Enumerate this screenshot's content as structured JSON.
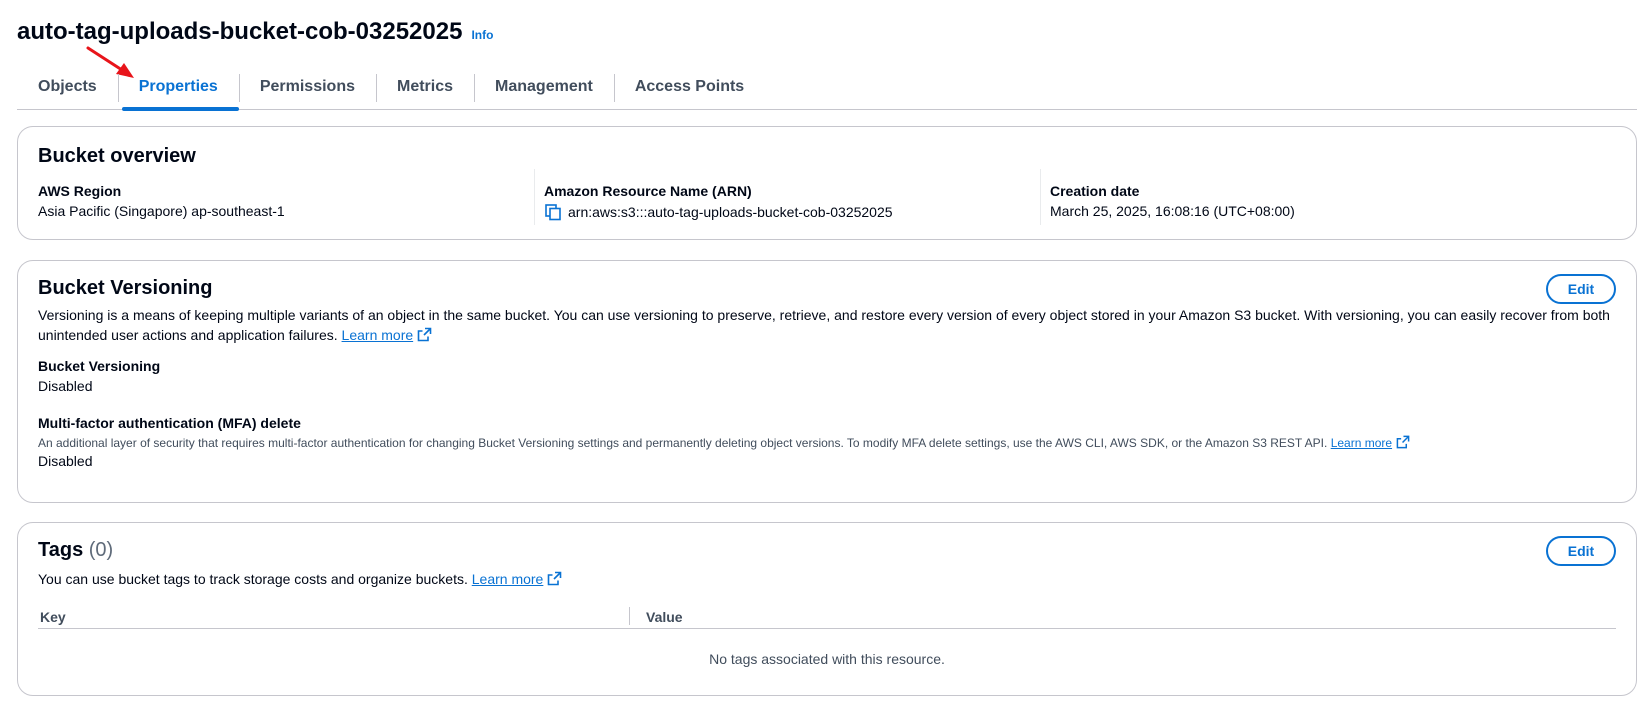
{
  "header": {
    "title": "auto-tag-uploads-bucket-cob-03252025",
    "info_label": "Info"
  },
  "tabs": [
    {
      "label": "Objects",
      "active": false
    },
    {
      "label": "Properties",
      "active": true
    },
    {
      "label": "Permissions",
      "active": false
    },
    {
      "label": "Metrics",
      "active": false
    },
    {
      "label": "Management",
      "active": false
    },
    {
      "label": "Access Points",
      "active": false
    }
  ],
  "overview": {
    "title": "Bucket overview",
    "region_label": "AWS Region",
    "region_value": "Asia Pacific (Singapore) ap-southeast-1",
    "arn_label": "Amazon Resource Name (ARN)",
    "arn_value": "arn:aws:s3:::auto-tag-uploads-bucket-cob-03252025",
    "creation_label": "Creation date",
    "creation_value": "March 25, 2025, 16:08:16 (UTC+08:00)"
  },
  "versioning": {
    "title": "Bucket Versioning",
    "edit_label": "Edit",
    "description": "Versioning is a means of keeping multiple variants of an object in the same bucket. You can use versioning to preserve, retrieve, and restore every version of every object stored in your Amazon S3 bucket. With versioning, you can easily recover from both unintended user actions and application failures.",
    "learn_more": "Learn more",
    "status_label": "Bucket Versioning",
    "status_value": "Disabled",
    "mfa_label": "Multi-factor authentication (MFA) delete",
    "mfa_description": "An additional layer of security that requires multi-factor authentication for changing Bucket Versioning settings and permanently deleting object versions. To modify MFA delete settings, use the AWS CLI, AWS SDK, or the Amazon S3 REST API.",
    "mfa_learn_more": "Learn more",
    "mfa_value": "Disabled"
  },
  "tags": {
    "title": "Tags",
    "count": "(0)",
    "edit_label": "Edit",
    "description": "You can use bucket tags to track storage costs and organize buckets.",
    "learn_more": "Learn more",
    "columns": [
      "Key",
      "Value"
    ],
    "empty_message": "No tags associated with this resource."
  },
  "colors": {
    "accent": "#0972d3",
    "annotation_arrow": "#e8141a"
  },
  "icons": {
    "copy": "copy-icon",
    "external_link": "external-link-icon",
    "annotation": "red-arrow-annotation"
  }
}
